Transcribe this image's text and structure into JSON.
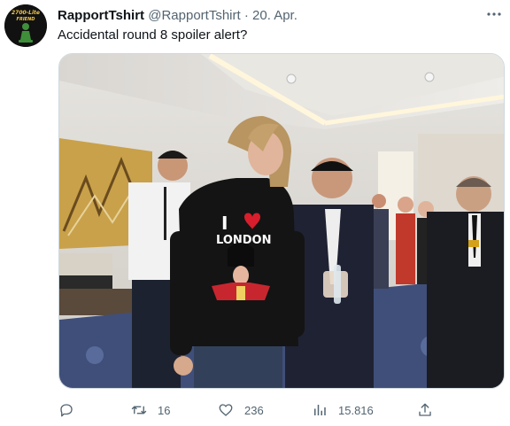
{
  "author": {
    "display_name": "RapportTshirt",
    "handle": "@RapportTshirt",
    "separator": "·",
    "date": "20. Apr.",
    "avatar_text_top": "2700-Lite",
    "avatar_text_bottom": "FRIEND"
  },
  "post": {
    "text": "Accidental round 8 spoiler alert?",
    "image": {
      "shirt_print_i": "I",
      "shirt_print_city": "LONDON",
      "icons": [
        "heart-icon"
      ]
    }
  },
  "actions": {
    "reply": {
      "icon": "reply-icon",
      "count": ""
    },
    "repost": {
      "icon": "repost-icon",
      "count": "16"
    },
    "like": {
      "icon": "heart-icon",
      "count": "236"
    },
    "views": {
      "icon": "views-icon",
      "count": "15.816"
    },
    "share": {
      "icon": "share-icon",
      "count": ""
    }
  },
  "more_menu": {
    "icon": "more-icon"
  },
  "colors": {
    "text": "#0f1419",
    "secondary": "#536471",
    "background": "#ffffff",
    "avatar_text": "#f2c84b",
    "avatar_figure": "#3f8f3a"
  }
}
